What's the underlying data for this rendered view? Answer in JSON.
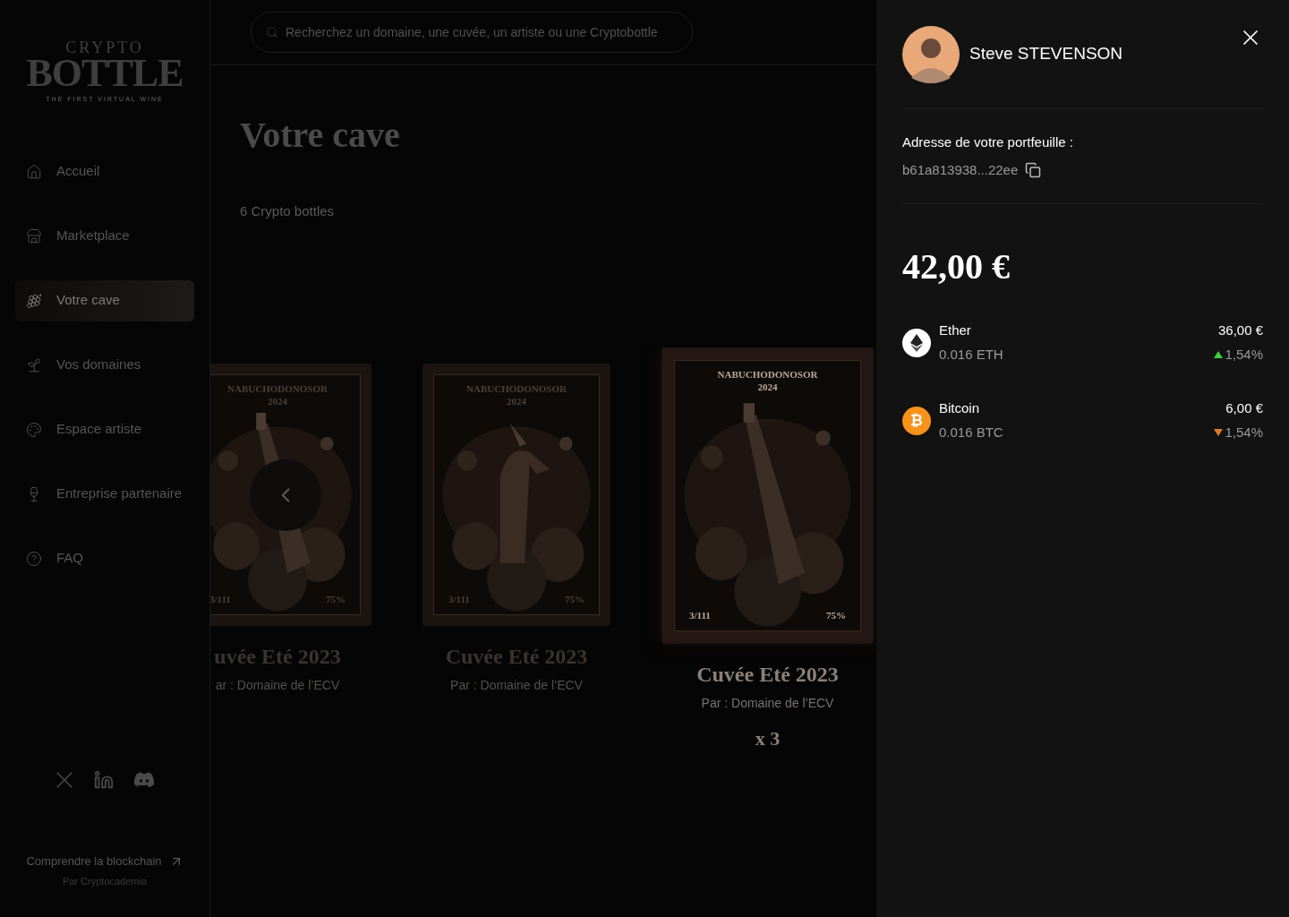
{
  "logo": {
    "top": "CRYPTO",
    "main": "BOTTLE",
    "tagline": "THE FIRST VIRTUAL WINE"
  },
  "sidebar": {
    "items": [
      {
        "label": "Accueil",
        "selected": false
      },
      {
        "label": "Marketplace",
        "selected": false
      },
      {
        "label": "Votre cave",
        "selected": true
      },
      {
        "label": "Vos domaines",
        "selected": false
      },
      {
        "label": "Espace artiste",
        "selected": false
      },
      {
        "label": "Entreprise partenaire",
        "selected": false
      },
      {
        "label": "FAQ",
        "selected": false
      }
    ],
    "promo": {
      "title": "Comprendre la blockchain",
      "subtitle": "Par Cryptocademia"
    }
  },
  "search": {
    "placeholder": "Recherchez un domaine, une cuvée, un artiste ou une Cryptobottle"
  },
  "page": {
    "title": "Votre cave",
    "count": "6 Crypto bottles"
  },
  "bottles": [
    {
      "name": "uvée Eté 2023",
      "producer": "ar : Domaine de l’ECV",
      "art_title": "NABUCHODONOSOR",
      "art_year": "2024",
      "edition": "3/111",
      "abv": "75%",
      "selected": false
    },
    {
      "name": "Cuvée Eté 2023",
      "producer": "Par : Domaine de l’ECV",
      "art_title": "NABUCHODONOSOR",
      "art_year": "2024",
      "edition": "3/111",
      "abv": "75%",
      "selected": false
    },
    {
      "name": "Cuvée Eté 2023",
      "producer": "Par : Domaine de l’ECV",
      "art_title": "NABUCHODONOSOR",
      "art_year": "2024",
      "edition": "3/111",
      "abv": "75%",
      "selected": true,
      "quantity": "x 3"
    }
  ],
  "wallet": {
    "user": "Steve STEVENSON",
    "address_label": "Adresse de votre portfeuille :",
    "address": "b61a813938...22ee",
    "total": "42,00 €",
    "assets": [
      {
        "name": "Ether",
        "amount": "0.016 ETH",
        "value": "36,00 €",
        "change": "1,54%",
        "rising": true,
        "kind": "eth",
        "color": "#ffffff"
      },
      {
        "name": "Bitcoin",
        "amount": "0.016 BTC",
        "value": "6,00 €",
        "change": "1,54%",
        "rising": false,
        "kind": "btc",
        "color": "#f7931a",
        "symbol": "₿"
      }
    ]
  }
}
